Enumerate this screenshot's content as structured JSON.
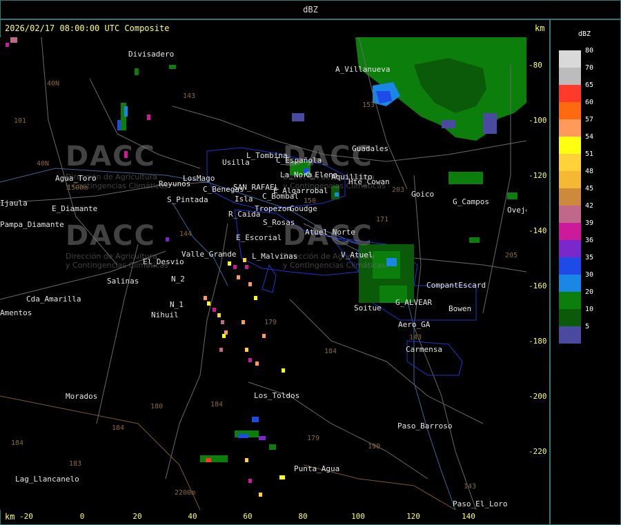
{
  "header": {
    "title": "dBZ"
  },
  "map": {
    "title": "2026/02/17 08:00:00 UTC Composite",
    "unit": "km",
    "y_ticks": [
      "-80",
      "-100",
      "-120",
      "-140",
      "-160",
      "-180",
      "-200",
      "-220"
    ],
    "x_ticks": [
      "-20",
      "0",
      "20",
      "40",
      "60",
      "80",
      "100",
      "120",
      "140"
    ],
    "places": [
      {
        "name": "Divisadero"
      },
      {
        "name": "A_Villanueva"
      },
      {
        "name": "Guadales"
      },
      {
        "name": "Usilla"
      },
      {
        "name": "L_Tombina"
      },
      {
        "name": "C_Española"
      },
      {
        "name": "La_Nora"
      },
      {
        "name": "C_Elena"
      },
      {
        "name": "Aquillito"
      },
      {
        "name": "Hte_Cowan"
      },
      {
        "name": "Goico"
      },
      {
        "name": "G_Campos"
      },
      {
        "name": "Agua_Toro"
      },
      {
        "name": "Reyunos"
      },
      {
        "name": "LosMago"
      },
      {
        "name": "C_Benegas"
      },
      {
        "name": "SAN_RAFAEL"
      },
      {
        "name": "E_Algarrobal"
      },
      {
        "name": "C_Bombal"
      },
      {
        "name": "S_Pintada"
      },
      {
        "name": "Isla"
      },
      {
        "name": "Pampa_Diamante"
      },
      {
        "name": "Ijaula"
      },
      {
        "name": "E_Diamante"
      },
      {
        "name": "R_Caida"
      },
      {
        "name": "Tropezon"
      },
      {
        "name": "Goudge"
      },
      {
        "name": "S_Rosas"
      },
      {
        "name": "Atuel_Norte"
      },
      {
        "name": "E_Escorial"
      },
      {
        "name": "Valle_Grande"
      },
      {
        "name": "L_Malvinas"
      },
      {
        "name": "V_Atuel"
      },
      {
        "name": "El_Desvio"
      },
      {
        "name": "Salinas"
      },
      {
        "name": "N_2"
      },
      {
        "name": "Cda_Amarilla"
      },
      {
        "name": "N_1"
      },
      {
        "name": "Nihuil"
      },
      {
        "name": "Amentos"
      },
      {
        "name": "CompantEscard"
      },
      {
        "name": "G_ALVEAR"
      },
      {
        "name": "Soitue"
      },
      {
        "name": "Bowen"
      },
      {
        "name": "Aero_GA"
      },
      {
        "name": "Carmensa"
      },
      {
        "name": "Los_Toldos"
      },
      {
        "name": "Morados"
      },
      {
        "name": "Paso_Barroso"
      },
      {
        "name": "Punta_Agua"
      },
      {
        "name": "Lag_Llancanelo"
      },
      {
        "name": "Paso_El_Loro"
      },
      {
        "name": "Oveje"
      },
      {
        "name": "1500m"
      },
      {
        "name": "2200m"
      }
    ],
    "routes": [
      "40N",
      "101",
      "40N",
      "153",
      "143",
      "144",
      "171",
      "203",
      "179",
      "184",
      "184",
      "179",
      "190",
      "180",
      "183",
      "184",
      "205",
      "143",
      "153",
      "150",
      "184",
      "143"
    ],
    "watermark": {
      "logo": "DACC",
      "line1": "Dirección de Agricultura",
      "line2": "y Contingencias Climáticas"
    }
  },
  "legend": {
    "title": "dBZ",
    "entries": [
      {
        "label": "80",
        "color": "#d9d9d9"
      },
      {
        "label": "70",
        "color": "#bcbcbc"
      },
      {
        "label": "65",
        "color": "#ff3a2a"
      },
      {
        "label": "60",
        "color": "#ff6a10"
      },
      {
        "label": "57",
        "color": "#ff9a5a"
      },
      {
        "label": "54",
        "color": "#ffff10"
      },
      {
        "label": "51",
        "color": "#ffd23a"
      },
      {
        "label": "48",
        "color": "#f4b834"
      },
      {
        "label": "45",
        "color": "#cd8a3c"
      },
      {
        "label": "42",
        "color": "#c0688a"
      },
      {
        "label": "39",
        "color": "#cc1a9a"
      },
      {
        "label": "36",
        "color": "#7a28cc"
      },
      {
        "label": "35",
        "color": "#1e4ae8"
      },
      {
        "label": "30",
        "color": "#1a86e6"
      },
      {
        "label": "20",
        "color": "#0c7e0c"
      },
      {
        "label": "10",
        "color": "#0a5a0a"
      },
      {
        "label": "5",
        "color": "#4a4aa0"
      }
    ]
  }
}
